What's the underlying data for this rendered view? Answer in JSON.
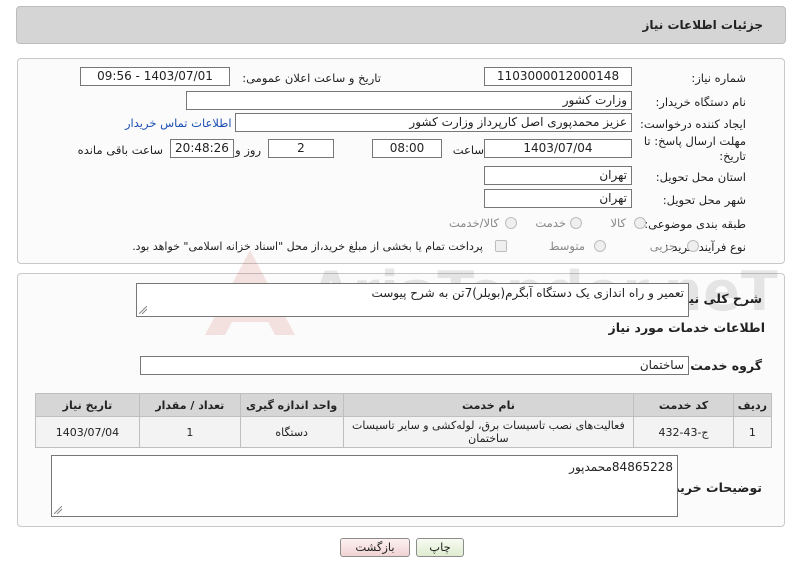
{
  "header": {
    "title": "جزئیات اطلاعات نیاز"
  },
  "form": {
    "need_number_label": "شماره نیاز:",
    "need_number": "1103000012000148",
    "announce_label": "تاریخ و ساعت اعلان عمومی:",
    "announce_value": "1403/07/01 - 09:56",
    "buyer_org_label": "نام دستگاه خریدار:",
    "buyer_org": "وزارت کشور",
    "creator_label": "ایجاد کننده درخواست:",
    "creator": "عزیز محمدپوری اصل کارپرداز وزارت کشور",
    "contact_link": "اطلاعات تماس خریدار",
    "deadline_label_1": "مهلت ارسال پاسخ: تا",
    "deadline_label_2": "تاریخ:",
    "deadline_date": "1403/07/04",
    "time_label": "ساعت",
    "deadline_time": "08:00",
    "days_value": "2",
    "days_label": "روز و",
    "remaining_time": "20:48:26",
    "remaining_label": "ساعت باقی مانده",
    "province_label": "استان محل تحویل:",
    "province": "تهران",
    "city_label": "شهر محل تحویل:",
    "city": "تهران",
    "category_label": "طبقه بندی موضوعی:",
    "category_options": [
      "کالا",
      "خدمت",
      "کالا/خدمت"
    ],
    "process_label": "نوع فرآیند خرید :",
    "process_options": [
      "جزیی",
      "متوسط"
    ],
    "payment_note": "پرداخت تمام یا بخشی از مبلغ خرید،از محل \"اسناد خزانه اسلامی\" خواهد بود."
  },
  "description": {
    "label": "شرح کلی نیاز:",
    "value": "تعمیر و راه اندازی یک دستگاه آبگرم(بویلر)7تن به شرح پیوست"
  },
  "services": {
    "section_title": "اطلاعات خدمات مورد نیاز",
    "group_label": "گروه خدمت:",
    "group_value": "ساختمان",
    "columns": [
      "ردیف",
      "کد خدمت",
      "نام خدمت",
      "واحد اندازه گیری",
      "تعداد / مقدار",
      "تاریخ نیاز"
    ],
    "rows": [
      {
        "index": "1",
        "code": "ج-43-432",
        "name": "فعالیت‌های نصب تاسیسات برق، لوله‌کشی و سایر تاسیسات ساختمان",
        "unit": "دستگاه",
        "qty": "1",
        "date": "1403/07/04"
      }
    ]
  },
  "buyer_notes": {
    "label": "توضیحات خریدار:",
    "value": "84865228محمدپور"
  },
  "buttons": {
    "print": "چاپ",
    "back": "بازگشت"
  },
  "watermark": {
    "text": "AriaTender.neT"
  }
}
